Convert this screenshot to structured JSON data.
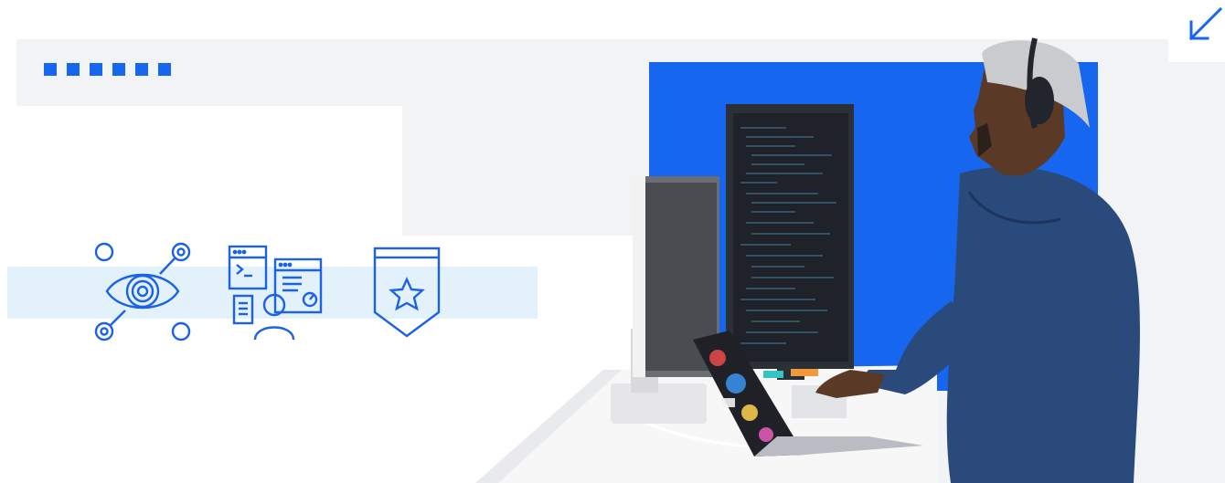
{
  "colors": {
    "brand_blue": "#1666f0",
    "icon_blue": "#1b62e6",
    "panel_grey": "#f2f3f5",
    "light_blue_strip": "#e3f1fb"
  },
  "decorations": {
    "dot_count": 6
  },
  "icons": {
    "collapse": "arrow-down-left-icon",
    "features": [
      "eye-network-icon",
      "developer-tools-icon",
      "star-badge-icon"
    ]
  },
  "photo": {
    "subject": "developer-at-standing-desk"
  }
}
